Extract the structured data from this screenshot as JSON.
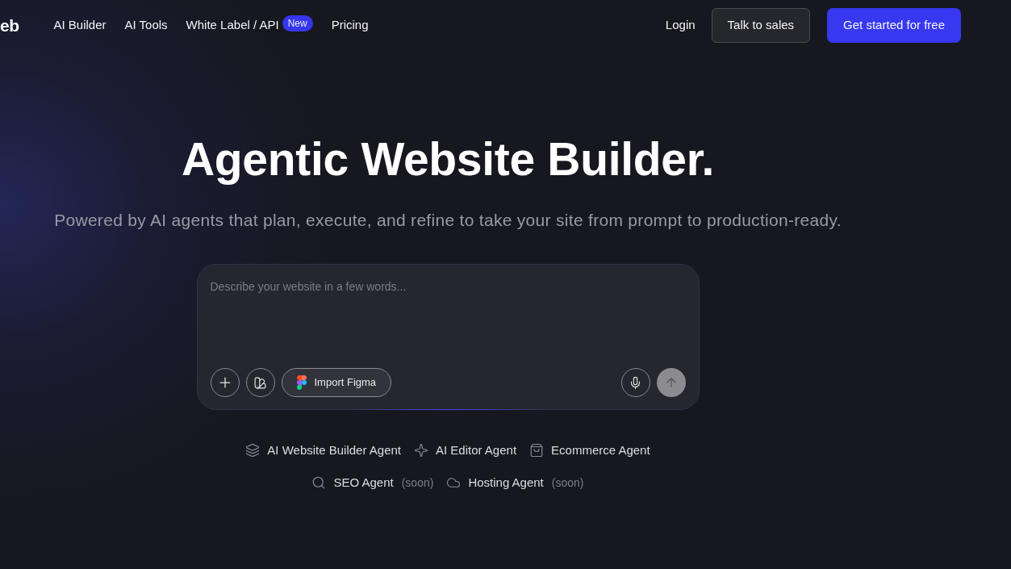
{
  "logo": {
    "text": "eb"
  },
  "nav": {
    "links": [
      {
        "label": "AI Builder"
      },
      {
        "label": "AI Tools"
      },
      {
        "label": "White Label / API",
        "badge": "New"
      },
      {
        "label": "Pricing"
      }
    ],
    "login": "Login",
    "buttons": [
      {
        "label": "Talk to sales",
        "kind": "secondary"
      },
      {
        "label": "Get started for free",
        "kind": "primary"
      }
    ]
  },
  "hero": {
    "title": "Agentic Website Builder.",
    "subtitle": "Powered by AI agents that plan, execute, and refine to take your site from prompt to production-ready."
  },
  "prompt": {
    "placeholder": "Describe your website in a few words...",
    "tools": [
      {
        "kind": "add"
      },
      {
        "kind": "swatches"
      },
      {
        "kind": "figma",
        "label": "Import Figma"
      }
    ],
    "actions": [
      {
        "kind": "mic"
      },
      {
        "kind": "send",
        "disabled": true
      }
    ]
  },
  "agent_rows": [
    [
      {
        "kind": "layers",
        "label": "AI Website Builder Agent"
      },
      {
        "kind": "sparkle",
        "label": "AI Editor Agent"
      },
      {
        "kind": "bag",
        "label": "Ecommerce Agent"
      }
    ],
    [
      {
        "kind": "search",
        "label": "SEO Agent",
        "note": "(soon)"
      },
      {
        "kind": "cloud",
        "label": "Hosting Agent",
        "note": "(soon)"
      }
    ]
  ]
}
